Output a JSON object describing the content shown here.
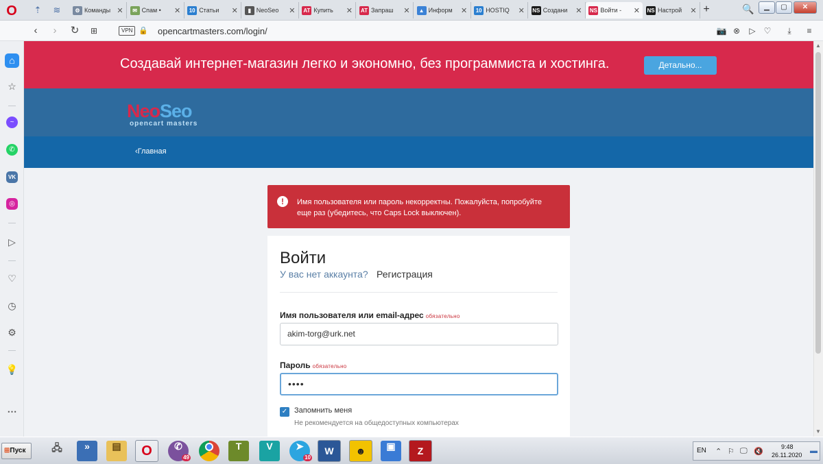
{
  "browser": {
    "tabs": [
      {
        "label": "Команды",
        "favicon": "proxy-icon",
        "fav_color": "#7a8aa0",
        "fav_glyph": "⚙"
      },
      {
        "label": "Спам • ",
        "favicon": "mail-icon",
        "fav_color": "#7aa35a",
        "fav_glyph": "✉"
      },
      {
        "label": "Статьи",
        "favicon": "ten-icon",
        "fav_color": "#2b7fd0",
        "fav_glyph": "10"
      },
      {
        "label": "NeoSeo",
        "favicon": "doc-icon",
        "fav_color": "#555555",
        "fav_glyph": "▮"
      },
      {
        "label": "Купить",
        "favicon": "at-icon",
        "fav_color": "#d7294c",
        "fav_glyph": "AT"
      },
      {
        "label": "Запраш",
        "favicon": "at-icon",
        "fav_color": "#d7294c",
        "fav_glyph": "AT"
      },
      {
        "label": "Информ",
        "favicon": "ads-icon",
        "fav_color": "#3b82d6",
        "fav_glyph": "▲"
      },
      {
        "label": "HOSTIQ",
        "favicon": "ten-icon",
        "fav_color": "#2b7fd0",
        "fav_glyph": "10"
      },
      {
        "label": "Создани",
        "favicon": "ns-icon",
        "fav_color": "#1a1a1a",
        "fav_glyph": "NS"
      },
      {
        "label": "Войти -",
        "favicon": "ns-icon",
        "fav_color": "#d7294c",
        "fav_glyph": "NS"
      },
      {
        "label": "Настрой",
        "favicon": "ns-icon",
        "fav_color": "#1a1a1a",
        "fav_glyph": "NS"
      }
    ],
    "url": "opencartmasters.com/login/",
    "vpn_label": "VPN"
  },
  "promo": {
    "text": "Создавай интернет-магазин легко и экономно, без программиста и хостинга.",
    "button": "Детально..."
  },
  "logo": {
    "part1": "Neo",
    "part2": "Seo",
    "subtitle": "opencart masters"
  },
  "nav": {
    "home": "Главная"
  },
  "alert": {
    "text": "Имя пользователя или пароль некорректны. Пожалуйста, попробуйте еще раз (убедитесь, что Caps Lock выключен)."
  },
  "login": {
    "title": "Войти",
    "no_account": "У вас нет аккаунта?",
    "register": "Регистрация",
    "username_label": "Имя пользователя или email-адрес",
    "required": "обязательно",
    "username_value": "akim-torg@urk.net",
    "password_label": "Пароль",
    "password_value": "••••",
    "remember_label": "Запомнить меня",
    "remember_hint": "Не рекомендуется на общедоступных компьютерах",
    "remember_checked": true
  },
  "taskbar": {
    "start_label": "Пуск",
    "viber_badge": "49",
    "telegram_badge": "10",
    "lang": "EN",
    "time": "9:48",
    "date": "26.11.2020"
  },
  "colors": {
    "promo_bg": "#d7294c",
    "header_bg": "#2e6b9e",
    "nav_bg": "#1467a8",
    "alert_bg": "#c9303a",
    "button_blue": "#4aa5e0"
  }
}
